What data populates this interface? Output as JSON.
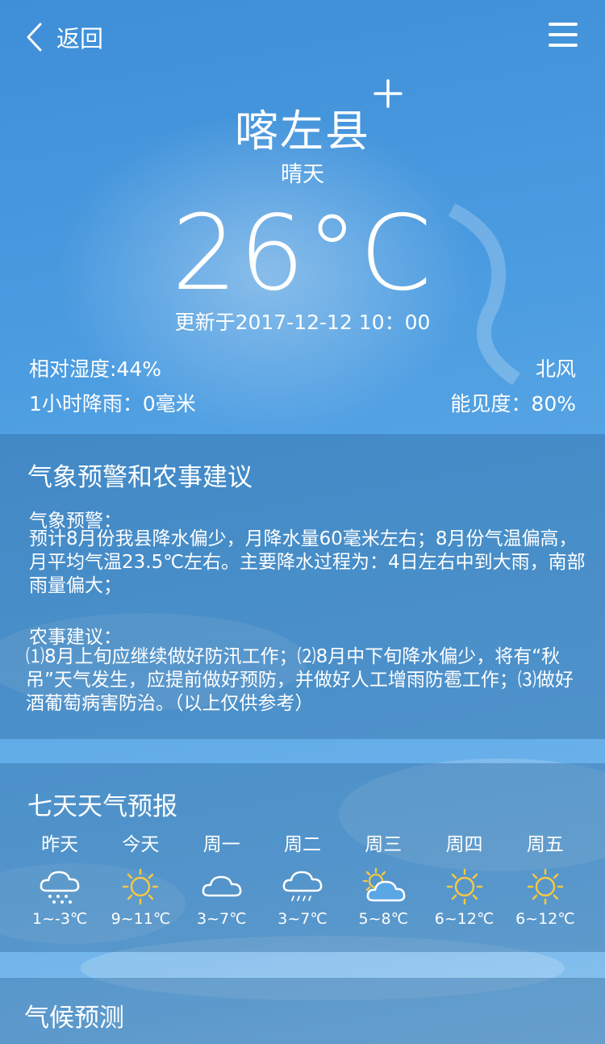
{
  "header": {
    "back_label": "返回"
  },
  "current": {
    "city": "喀左县",
    "condition": "晴天",
    "temperature": "26°C",
    "updated": "更新于2017-12-12  10：00",
    "humidity": "相对湿度:44%",
    "rain": "1小时降雨：0毫米",
    "wind": "北风",
    "visibility": "能见度：80%"
  },
  "alerts": {
    "title": "气象预警和农事建议",
    "warning_heading": "气象预警：",
    "warning_text": "预计8月份我县降水偏少，月降水量60毫米左右；8月份气温偏高，月平均气温23.5℃左右。主要降水过程为：4日左右中到大雨，南部雨量偏大；",
    "advice_heading": "农事建议：",
    "advice_text": "⑴8月上旬应继续做好防汛工作；⑵8月中下旬降水偏少，将有“秋吊”天气发生，应提前做好预防，并做好人工增雨防雹工作；⑶做好酒葡萄病害防治。（以上仅供参考）"
  },
  "forecast": {
    "title": "七天天气预报",
    "days": [
      {
        "name": "昨天",
        "icon": "snow-cloud-icon",
        "temp": "1~-3℃"
      },
      {
        "name": "今天",
        "icon": "sun-icon",
        "temp": "9~11℃"
      },
      {
        "name": "周一",
        "icon": "cloud-icon",
        "temp": "3~7℃"
      },
      {
        "name": "周二",
        "icon": "rain-cloud-icon",
        "temp": "3~7℃"
      },
      {
        "name": "周三",
        "icon": "partly-cloudy-icon",
        "temp": "5~8℃"
      },
      {
        "name": "周四",
        "icon": "sun-icon",
        "temp": "6~12℃"
      },
      {
        "name": "周五",
        "icon": "sun-icon",
        "temp": "6~12℃"
      }
    ]
  },
  "climate": {
    "title": "气候预测"
  },
  "colors": {
    "sun": "#f5c842",
    "panel": "#306ca0",
    "sky_top": "#3f8fd8"
  }
}
